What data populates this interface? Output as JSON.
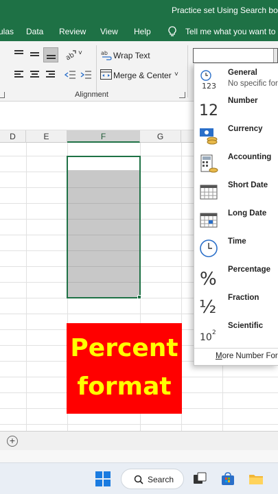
{
  "window": {
    "title": "Practice set Using Search box"
  },
  "menu": {
    "items": [
      "ulas",
      "Data",
      "Review",
      "View",
      "Help"
    ],
    "tell_me": "Tell me what you want to d"
  },
  "ribbon": {
    "wrap_text": "Wrap Text",
    "merge_center": "Merge & Center",
    "alignment_group": "Alignment",
    "dropdown_caret": "˅"
  },
  "columns": [
    "D",
    "E",
    "F",
    "G"
  ],
  "overlay": {
    "line1": "Percent",
    "line2": "format",
    "bg_color": "#ff0000",
    "text_color": "#ffff00"
  },
  "number_format": {
    "current_value": "",
    "options": [
      {
        "name": "General",
        "sub": "No specific for",
        "icon": "clock-123-icon"
      },
      {
        "name": "Number",
        "sub": "",
        "icon": "number-12-icon",
        "glyph": "12"
      },
      {
        "name": "Currency",
        "sub": "",
        "icon": "currency-icon"
      },
      {
        "name": "Accounting",
        "sub": "",
        "icon": "accounting-icon"
      },
      {
        "name": "Short Date",
        "sub": "",
        "icon": "short-date-icon"
      },
      {
        "name": "Long Date",
        "sub": "",
        "icon": "long-date-icon"
      },
      {
        "name": "Time",
        "sub": "",
        "icon": "clock-icon"
      },
      {
        "name": "Percentage",
        "sub": "",
        "icon": "percent-icon",
        "glyph": "%"
      },
      {
        "name": "Fraction",
        "sub": "",
        "icon": "fraction-icon",
        "glyph": "½"
      },
      {
        "name": "Scientific",
        "sub": "",
        "icon": "scientific-icon",
        "glyph": "10",
        "glyph_sup": "2"
      }
    ],
    "more_prefix": "M",
    "more_rest": "ore Number For"
  },
  "sheet": {
    "add_label": "+"
  },
  "taskbar": {
    "search_label": "Search"
  },
  "colors": {
    "excel_green": "#1e7145",
    "selection_fill": "#c8c8c8"
  }
}
